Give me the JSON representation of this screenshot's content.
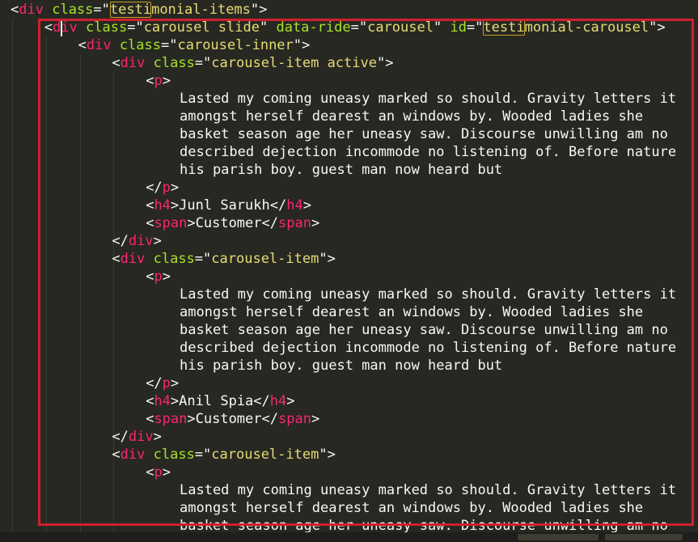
{
  "editor": {
    "lines": [
      {
        "indent": 0,
        "tokens": [
          {
            "t": "<",
            "c": "txt"
          },
          {
            "t": "div",
            "c": "tag"
          },
          {
            "t": " ",
            "c": "txt"
          },
          {
            "t": "class",
            "c": "attr"
          },
          {
            "t": "=\"",
            "c": "txt"
          },
          {
            "t": "testi",
            "c": "str",
            "m": true
          },
          {
            "t": "monial-items",
            "c": "str"
          },
          {
            "t": "\">",
            "c": "txt"
          }
        ]
      },
      {
        "indent": 1,
        "tokens": [
          {
            "t": "<",
            "c": "txt"
          },
          {
            "t": "div",
            "c": "tag"
          },
          {
            "t": " ",
            "c": "txt"
          },
          {
            "t": "class",
            "c": "attr"
          },
          {
            "t": "=\"",
            "c": "txt"
          },
          {
            "t": "carousel slide",
            "c": "str"
          },
          {
            "t": "\" ",
            "c": "txt"
          },
          {
            "t": "data-ride",
            "c": "attr"
          },
          {
            "t": "=\"",
            "c": "txt"
          },
          {
            "t": "carousel",
            "c": "str"
          },
          {
            "t": "\" ",
            "c": "txt"
          },
          {
            "t": "id",
            "c": "attr"
          },
          {
            "t": "=\"",
            "c": "txt"
          },
          {
            "t": "testi",
            "c": "str",
            "m": true
          },
          {
            "t": "monial-carousel",
            "c": "str"
          },
          {
            "t": "\">",
            "c": "txt"
          }
        ]
      },
      {
        "indent": 2,
        "tokens": [
          {
            "t": "<",
            "c": "txt"
          },
          {
            "t": "div",
            "c": "tag"
          },
          {
            "t": " ",
            "c": "txt"
          },
          {
            "t": "class",
            "c": "attr"
          },
          {
            "t": "=\"",
            "c": "txt"
          },
          {
            "t": "carousel-inner",
            "c": "str"
          },
          {
            "t": "\">",
            "c": "txt"
          }
        ]
      },
      {
        "indent": 3,
        "tokens": [
          {
            "t": "<",
            "c": "txt"
          },
          {
            "t": "div",
            "c": "tag"
          },
          {
            "t": " ",
            "c": "txt"
          },
          {
            "t": "class",
            "c": "attr"
          },
          {
            "t": "=\"",
            "c": "txt"
          },
          {
            "t": "carousel-item active",
            "c": "str"
          },
          {
            "t": "\">",
            "c": "txt"
          }
        ]
      },
      {
        "indent": 4,
        "tokens": [
          {
            "t": "<",
            "c": "txt"
          },
          {
            "t": "p",
            "c": "tag"
          },
          {
            "t": ">",
            "c": "txt"
          }
        ]
      },
      {
        "indent": 5,
        "tokens": [
          {
            "t": "Lasted my coming uneasy marked so should. Gravity letters it",
            "c": "txt"
          }
        ]
      },
      {
        "indent": 5,
        "tokens": [
          {
            "t": "amongst herself dearest an windows by. Wooded ladies she",
            "c": "txt"
          }
        ]
      },
      {
        "indent": 5,
        "tokens": [
          {
            "t": "basket season age her uneasy saw. Discourse unwilling am no",
            "c": "txt"
          }
        ]
      },
      {
        "indent": 5,
        "tokens": [
          {
            "t": "described dejection incommode no listening of. Before nature",
            "c": "txt"
          }
        ]
      },
      {
        "indent": 5,
        "tokens": [
          {
            "t": "his parish boy. guest man now heard but",
            "c": "txt"
          }
        ]
      },
      {
        "indent": 4,
        "tokens": [
          {
            "t": "</",
            "c": "txt"
          },
          {
            "t": "p",
            "c": "tag"
          },
          {
            "t": ">",
            "c": "txt"
          }
        ]
      },
      {
        "indent": 4,
        "tokens": [
          {
            "t": "<",
            "c": "txt"
          },
          {
            "t": "h4",
            "c": "tag"
          },
          {
            "t": ">Junl Sarukh</",
            "c": "txt"
          },
          {
            "t": "h4",
            "c": "tag"
          },
          {
            "t": ">",
            "c": "txt"
          }
        ]
      },
      {
        "indent": 4,
        "tokens": [
          {
            "t": "<",
            "c": "txt"
          },
          {
            "t": "span",
            "c": "tag"
          },
          {
            "t": ">Customer</",
            "c": "txt"
          },
          {
            "t": "span",
            "c": "tag"
          },
          {
            "t": ">",
            "c": "txt"
          }
        ]
      },
      {
        "indent": 3,
        "tokens": [
          {
            "t": "</",
            "c": "txt"
          },
          {
            "t": "div",
            "c": "tag"
          },
          {
            "t": ">",
            "c": "txt"
          }
        ]
      },
      {
        "indent": 3,
        "tokens": [
          {
            "t": "<",
            "c": "txt"
          },
          {
            "t": "div",
            "c": "tag"
          },
          {
            "t": " ",
            "c": "txt"
          },
          {
            "t": "class",
            "c": "attr"
          },
          {
            "t": "=\"",
            "c": "txt"
          },
          {
            "t": "carousel-item",
            "c": "str"
          },
          {
            "t": "\">",
            "c": "txt"
          }
        ]
      },
      {
        "indent": 4,
        "tokens": [
          {
            "t": "<",
            "c": "txt"
          },
          {
            "t": "p",
            "c": "tag"
          },
          {
            "t": ">",
            "c": "txt"
          }
        ]
      },
      {
        "indent": 5,
        "tokens": [
          {
            "t": "Lasted my coming uneasy marked so should. Gravity letters it",
            "c": "txt"
          }
        ]
      },
      {
        "indent": 5,
        "tokens": [
          {
            "t": "amongst herself dearest an windows by. Wooded ladies she",
            "c": "txt"
          }
        ]
      },
      {
        "indent": 5,
        "tokens": [
          {
            "t": "basket season age her uneasy saw. Discourse unwilling am no",
            "c": "txt"
          }
        ]
      },
      {
        "indent": 5,
        "tokens": [
          {
            "t": "described dejection incommode no listening of. Before nature",
            "c": "txt"
          }
        ]
      },
      {
        "indent": 5,
        "tokens": [
          {
            "t": "his parish boy. guest man now heard but",
            "c": "txt"
          }
        ]
      },
      {
        "indent": 4,
        "tokens": [
          {
            "t": "</",
            "c": "txt"
          },
          {
            "t": "p",
            "c": "tag"
          },
          {
            "t": ">",
            "c": "txt"
          }
        ]
      },
      {
        "indent": 4,
        "tokens": [
          {
            "t": "<",
            "c": "txt"
          },
          {
            "t": "h4",
            "c": "tag"
          },
          {
            "t": ">Anil Spia</",
            "c": "txt"
          },
          {
            "t": "h4",
            "c": "tag"
          },
          {
            "t": ">",
            "c": "txt"
          }
        ]
      },
      {
        "indent": 4,
        "tokens": [
          {
            "t": "<",
            "c": "txt"
          },
          {
            "t": "span",
            "c": "tag"
          },
          {
            "t": ">Customer</",
            "c": "txt"
          },
          {
            "t": "span",
            "c": "tag"
          },
          {
            "t": ">",
            "c": "txt"
          }
        ]
      },
      {
        "indent": 3,
        "tokens": [
          {
            "t": "</",
            "c": "txt"
          },
          {
            "t": "div",
            "c": "tag"
          },
          {
            "t": ">",
            "c": "txt"
          }
        ]
      },
      {
        "indent": 3,
        "tokens": [
          {
            "t": "<",
            "c": "txt"
          },
          {
            "t": "div",
            "c": "tag"
          },
          {
            "t": " ",
            "c": "txt"
          },
          {
            "t": "class",
            "c": "attr"
          },
          {
            "t": "=\"",
            "c": "txt"
          },
          {
            "t": "carousel-item",
            "c": "str"
          },
          {
            "t": "\">",
            "c": "txt"
          }
        ]
      },
      {
        "indent": 4,
        "tokens": [
          {
            "t": "<",
            "c": "txt"
          },
          {
            "t": "p",
            "c": "tag"
          },
          {
            "t": ">",
            "c": "txt"
          }
        ]
      },
      {
        "indent": 5,
        "tokens": [
          {
            "t": "Lasted my coming uneasy marked so should. Gravity letters it",
            "c": "txt"
          }
        ]
      },
      {
        "indent": 5,
        "tokens": [
          {
            "t": "amongst herself dearest an windows by. Wooded ladies she",
            "c": "txt"
          }
        ]
      },
      {
        "indent": 5,
        "tokens": [
          {
            "t": "basket season age her uneasy saw. Discourse unwilling am no",
            "c": "txt"
          }
        ]
      }
    ]
  },
  "colors": {
    "background": "#272822",
    "tag": "#f92672",
    "attribute": "#a6e22e",
    "string": "#e6db74",
    "text": "#f8f8f2",
    "highlight_box": "#d0202e",
    "match_outline": "#c9a227"
  }
}
